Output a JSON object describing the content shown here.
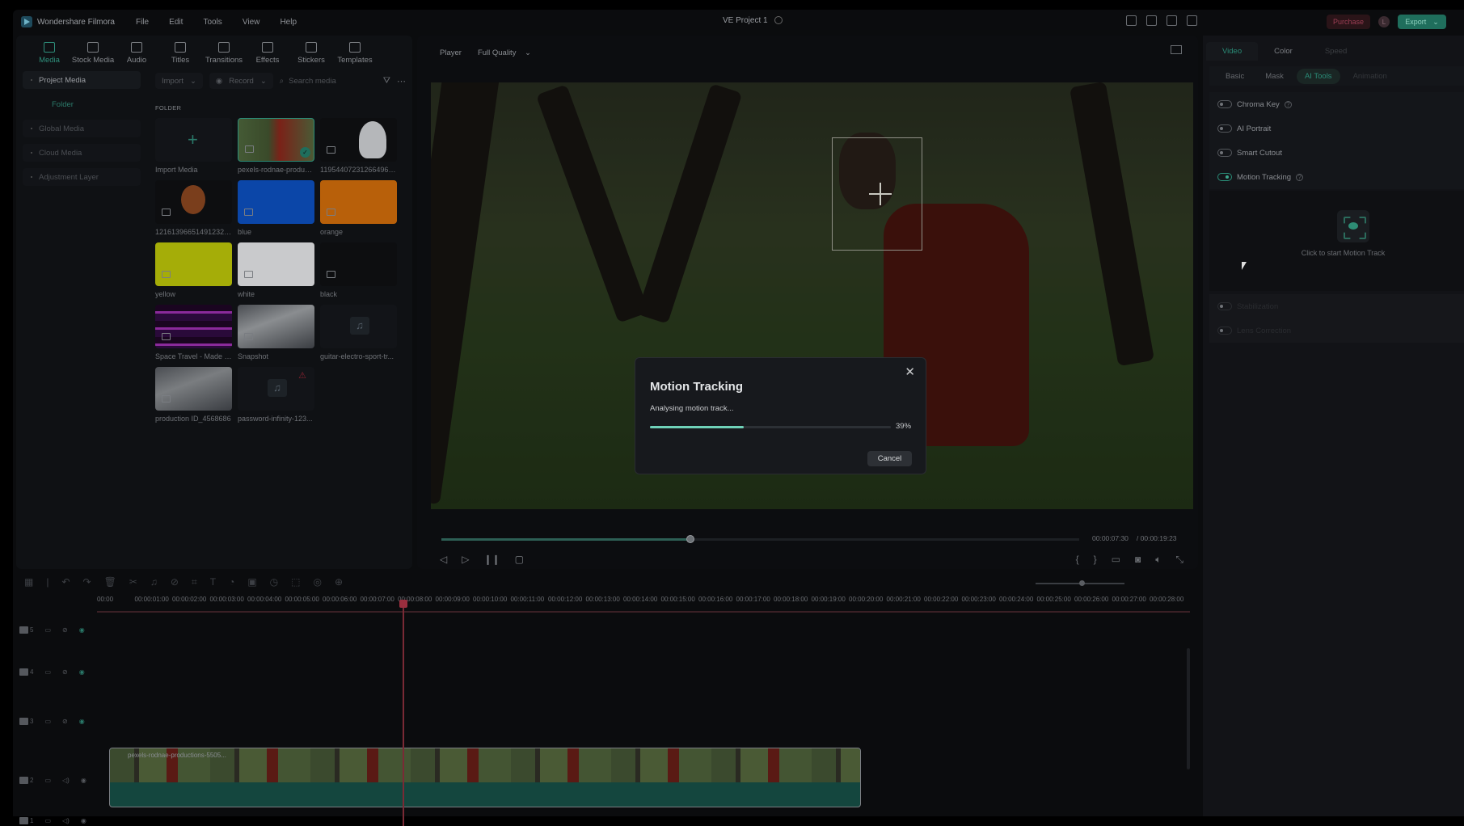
{
  "app": {
    "name": "Wondershare Filmora",
    "menu": [
      "File",
      "Edit",
      "Tools",
      "View",
      "Help"
    ],
    "project_title": "VE Project 1",
    "purchase_label": "Purchase",
    "avatar_initial": "L",
    "export_label": "Export"
  },
  "toolbar_tabs": [
    {
      "label": "Media",
      "icon": "media-icon",
      "active": true
    },
    {
      "label": "Stock Media",
      "icon": "stock-media-icon"
    },
    {
      "label": "Audio",
      "icon": "music-note-icon"
    },
    {
      "label": "Titles",
      "icon": "text-t-icon"
    },
    {
      "label": "Transitions",
      "icon": "transitions-icon"
    },
    {
      "label": "Effects",
      "icon": "effects-icon"
    },
    {
      "label": "Stickers",
      "icon": "stickers-icon"
    },
    {
      "label": "Templates",
      "icon": "templates-icon"
    }
  ],
  "sidebar": {
    "items": [
      {
        "label": "Project Media",
        "active": true
      },
      {
        "label": "Folder",
        "sub": true
      },
      {
        "label": "Global Media"
      },
      {
        "label": "Cloud Media"
      },
      {
        "label": "Adjustment Layer"
      }
    ]
  },
  "media_bar": {
    "import_label": "Import",
    "record_label": "Record",
    "search_placeholder": "Search media"
  },
  "folder_label": "FOLDER",
  "media_items": [
    {
      "name": "Import Media",
      "type": "import"
    },
    {
      "name": "pexels-rodnae-produc...",
      "type": "video",
      "selected": true
    },
    {
      "name": "1195440723126649600...",
      "type": "image"
    },
    {
      "name": "1216139665149123274...",
      "type": "image"
    },
    {
      "name": "blue",
      "type": "color",
      "color": "#0b46a8"
    },
    {
      "name": "orange",
      "type": "color",
      "color": "#b8600a"
    },
    {
      "name": "yellow",
      "type": "color",
      "color": "#a5ad08"
    },
    {
      "name": "white",
      "type": "color",
      "color": "#c9cacc"
    },
    {
      "name": "black",
      "type": "color",
      "color": "#0d0e10"
    },
    {
      "name": "Space Travel - Made w...",
      "type": "video"
    },
    {
      "name": "Snapshot",
      "type": "image"
    },
    {
      "name": "guitar-electro-sport-tr...",
      "type": "audio"
    },
    {
      "name": "production ID_4568686",
      "type": "video"
    },
    {
      "name": "password-infinity-123...",
      "type": "audio",
      "warning": true
    }
  ],
  "player": {
    "label": "Player",
    "quality": "Full Quality",
    "current_time": "00:00:07:30",
    "total_time": "/ 00:00:19:23",
    "progress_fraction": 0.39
  },
  "dialog": {
    "title": "Motion Tracking",
    "status": "Analysing motion track...",
    "progress_percent": 39,
    "progress_label": "39%",
    "cancel_label": "Cancel"
  },
  "right_panel": {
    "tabs": [
      "Video",
      "Color",
      "Speed"
    ],
    "subtabs": [
      "Basic",
      "Mask",
      "AI Tools",
      "Animation"
    ],
    "toggles": [
      {
        "label": "Chroma Key",
        "on": false,
        "help": true
      },
      {
        "label": "AI Portrait",
        "on": false
      },
      {
        "label": "Smart Cutout",
        "on": false
      },
      {
        "label": "Motion Tracking",
        "on": true,
        "help": true
      }
    ],
    "motion_track_hint": "Click to start Motion Track",
    "disabled_items": [
      "Stabilization",
      "Lens Correction"
    ]
  },
  "timeline": {
    "ruler": [
      "00:00",
      "00:00:01:00",
      "00:00:02:00",
      "00:00:03:00",
      "00:00:04:00",
      "00:00:05:00",
      "00:00:06:00",
      "00:00:07:00",
      "00:00:08:00",
      "00:00:09:00",
      "00:00:10:00",
      "00:00:11:00",
      "00:00:12:00",
      "00:00:13:00",
      "00:00:14:00",
      "00:00:15:00",
      "00:00:16:00",
      "00:00:17:00",
      "00:00:18:00",
      "00:00:19:00",
      "00:00:20:00",
      "00:00:21:00",
      "00:00:22:00",
      "00:00:23:00",
      "00:00:24:00",
      "00:00:25:00",
      "00:00:26:00",
      "00:00:27:00",
      "00:00:28:00"
    ],
    "tracks": [
      "5",
      "4",
      "3",
      "2",
      "1"
    ],
    "clip_name": "pexels-rodnae-productions-5505..."
  }
}
